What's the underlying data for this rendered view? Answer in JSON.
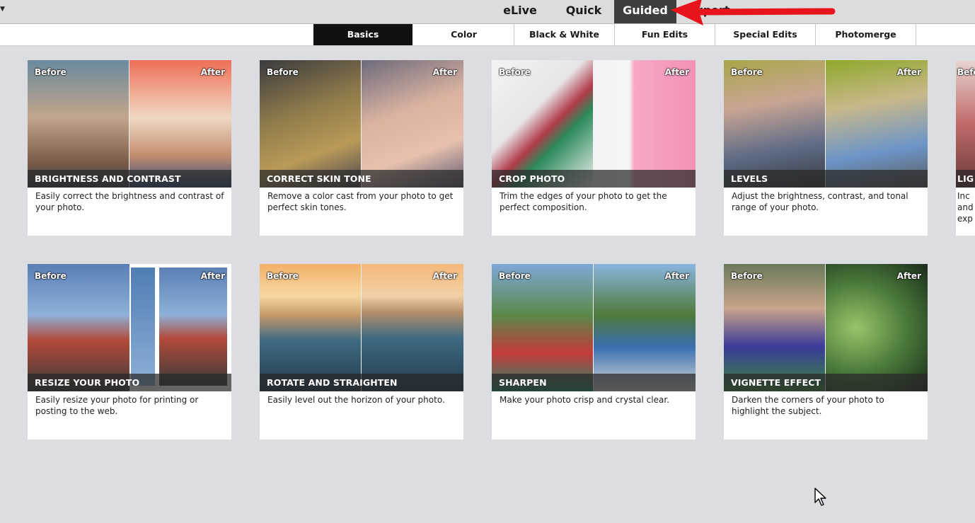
{
  "mode_tabs": [
    {
      "label": "eLive",
      "active": false
    },
    {
      "label": "Quick",
      "active": false
    },
    {
      "label": "Guided",
      "active": true
    },
    {
      "label": "Expert",
      "active": false
    }
  ],
  "sub_tabs": [
    {
      "label": "Basics",
      "active": true
    },
    {
      "label": "Color",
      "active": false
    },
    {
      "label": "Black & White",
      "active": false
    },
    {
      "label": "Fun Edits",
      "active": false
    },
    {
      "label": "Special Edits",
      "active": false
    },
    {
      "label": "Photomerge",
      "active": false
    }
  ],
  "before_label": "Before",
  "after_label": "After",
  "cards": [
    {
      "title": "BRIGHTNESS AND CONTRAST",
      "description": "Easily correct the brightness and contrast of your photo."
    },
    {
      "title": "CORRECT SKIN TONE",
      "description": "Remove a color cast from your photo to get perfect skin tones."
    },
    {
      "title": "CROP PHOTO",
      "description": "Trim the edges of your photo to get the perfect composition."
    },
    {
      "title": "LEVELS",
      "description": "Adjust the brightness, contrast, and tonal range of your photo."
    },
    {
      "title": "LIG",
      "description": "Inc and exp"
    },
    {
      "title": "RESIZE YOUR PHOTO",
      "description": "Easily resize your photo for printing or posting to the web."
    },
    {
      "title": "ROTATE AND STRAIGHTEN",
      "description": "Easily level out the horizon of your photo."
    },
    {
      "title": "SHARPEN",
      "description": "Make your photo crisp and crystal clear."
    },
    {
      "title": "VIGNETTE EFFECT",
      "description": "Darken the corners of your photo to highlight the subject."
    }
  ],
  "colors": {
    "annotation_arrow": "#e8141c",
    "active_mode_bg": "#3d3d3d",
    "active_subtab_bg": "#111111"
  },
  "icons": {
    "annotation": "red-arrow-icon",
    "pointer": "mouse-cursor-icon"
  }
}
